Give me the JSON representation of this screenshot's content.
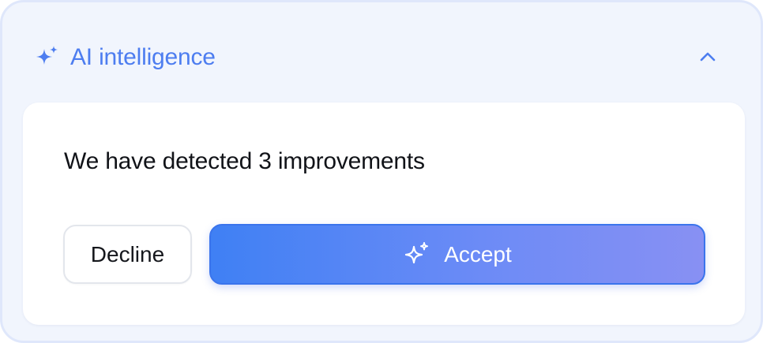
{
  "header": {
    "title": "AI intelligence",
    "icon": "sparkle-icon",
    "collapse_icon": "chevron-up-icon"
  },
  "card": {
    "message": "We have detected 3 improvements"
  },
  "actions": {
    "decline_label": "Decline",
    "accept_label": "Accept",
    "accept_icon": "sparkle-outline-icon"
  },
  "colors": {
    "accent": "#4d7df0",
    "panel_bg": "#f1f5fd",
    "accept_gradient_start": "#3f80f4",
    "accept_gradient_end": "#8890f3"
  }
}
